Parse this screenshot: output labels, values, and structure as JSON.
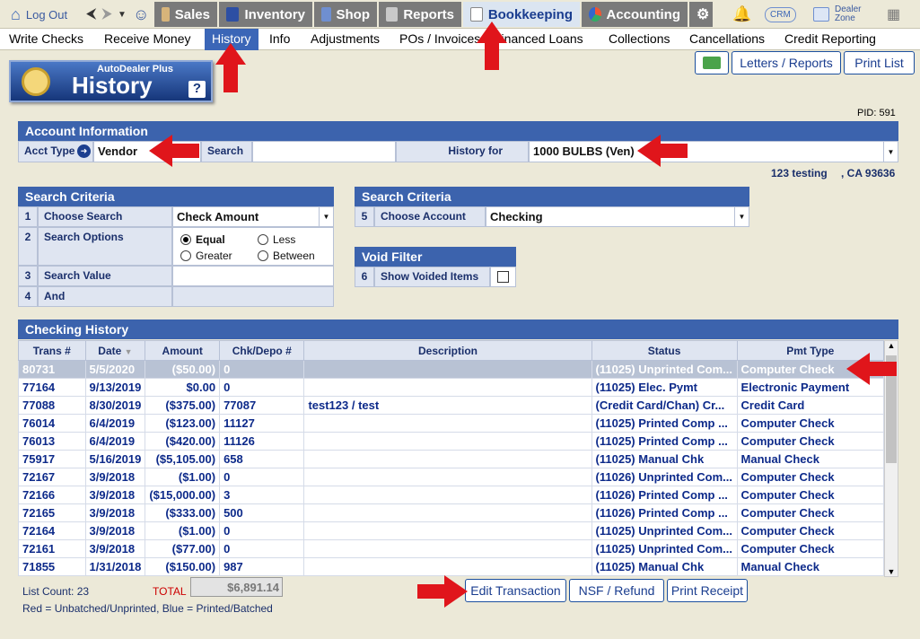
{
  "topbar": {
    "logout": "Log Out",
    "tabs": [
      "Sales",
      "Inventory",
      "Shop",
      "Reports",
      "Bookkeeping",
      "Accounting"
    ],
    "crm": "CRM",
    "dealer_zone": "Dealer Zone"
  },
  "subnav": [
    "Write Checks",
    "Receive Money",
    "History",
    "Info",
    "Adjustments",
    "POs / Invoices",
    "Financed Loans",
    "Collections",
    "Cancellations",
    "Credit Reporting"
  ],
  "buttons": {
    "letters_reports": "Letters / Reports",
    "print_list": "Print List",
    "edit_transaction": "Edit Transaction",
    "nsf_refund": "NSF / Refund",
    "print_receipt": "Print Receipt"
  },
  "page_header": {
    "brand": "AutoDealer Plus",
    "title": "History",
    "help": "?"
  },
  "pid": "PID: 591",
  "account_info": {
    "title": "Account Information",
    "acct_type_label": "Acct Type",
    "acct_type_value": "Vendor",
    "search_label": "Search",
    "search_value": "",
    "history_for_label": "History for",
    "history_for_value": "1000 BULBS (Ven)",
    "address_line": "123 testing",
    "city_line": ", CA 93636"
  },
  "search_criteria_left": {
    "title": "Search Criteria",
    "rows": [
      {
        "num": "1",
        "label": "Choose Search",
        "value": "Check Amount"
      },
      {
        "num": "2",
        "label": "Search Options"
      },
      {
        "num": "3",
        "label": "Search Value",
        "value": ""
      },
      {
        "num": "4",
        "label": "And",
        "value": ""
      }
    ],
    "options": [
      "Equal",
      "Less",
      "Greater",
      "Between"
    ],
    "selected_option": "Equal"
  },
  "search_criteria_right": {
    "title": "Search Criteria",
    "num": "5",
    "label": "Choose Account",
    "value": "Checking"
  },
  "void_filter": {
    "title": "Void Filter",
    "num": "6",
    "label": "Show Voided Items",
    "checked": false
  },
  "history": {
    "title": "Checking History",
    "columns": [
      "Trans #",
      "Date",
      "Amount",
      "Chk/Depo #",
      "Description",
      "Status",
      "Pmt Type"
    ],
    "rows": [
      [
        "80731",
        "5/5/2020",
        "($50.00)",
        "0",
        "",
        "(11025) Unprinted Com...",
        "Computer Check"
      ],
      [
        "77164",
        "9/13/2019",
        "$0.00",
        "0",
        "",
        "(11025) Elec. Pymt",
        "Electronic Payment"
      ],
      [
        "77088",
        "8/30/2019",
        "($375.00)",
        "77087",
        "test123 / test",
        "(Credit Card/Chan) Cr...",
        "Credit Card"
      ],
      [
        "76014",
        "6/4/2019",
        "($123.00)",
        "11127",
        "",
        "(11025) Printed Comp ...",
        "Computer Check"
      ],
      [
        "76013",
        "6/4/2019",
        "($420.00)",
        "11126",
        "",
        "(11025) Printed Comp ...",
        "Computer Check"
      ],
      [
        "75917",
        "5/16/2019",
        "($5,105.00)",
        "658",
        "",
        "(11025) Manual Chk",
        "Manual Check"
      ],
      [
        "72167",
        "3/9/2018",
        "($1.00)",
        "0",
        "",
        "(11026) Unprinted Com...",
        "Computer Check"
      ],
      [
        "72166",
        "3/9/2018",
        "($15,000.00)",
        "3",
        "",
        "(11026) Printed Comp ...",
        "Computer Check"
      ],
      [
        "72165",
        "3/9/2018",
        "($333.00)",
        "500",
        "",
        "(11026) Printed Comp ...",
        "Computer Check"
      ],
      [
        "72164",
        "3/9/2018",
        "($1.00)",
        "0",
        "",
        "(11025) Unprinted Com...",
        "Computer Check"
      ],
      [
        "72161",
        "3/9/2018",
        "($77.00)",
        "0",
        "",
        "(11025) Unprinted Com...",
        "Computer Check"
      ],
      [
        "71855",
        "1/31/2018",
        "($150.00)",
        "987",
        "",
        "(11025) Manual Chk",
        "Manual Check"
      ]
    ],
    "selected_row": 0
  },
  "footer": {
    "list_count": "List Count: 23",
    "total_label": "TOTAL",
    "total_value": "$6,891.14",
    "legend": "Red = Unbatched/Unprinted, Blue = Printed/Batched"
  },
  "colors": {
    "accent": "#3c63ad",
    "annotation_arrow": "#e0151b",
    "selected_row": "#b8c2d4"
  }
}
